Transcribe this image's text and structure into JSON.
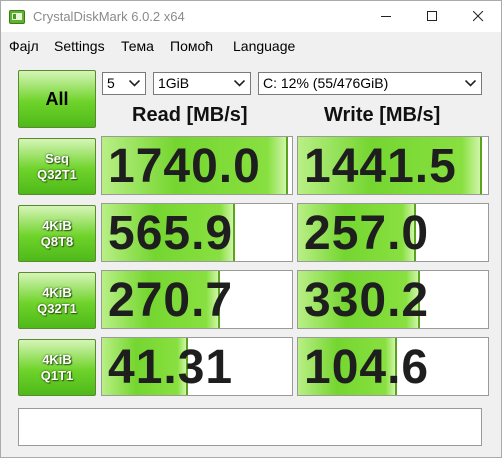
{
  "window": {
    "title": "CrystalDiskMark 6.0.2 x64"
  },
  "menu": [
    "Фајл",
    "Settings",
    "Тема",
    "Помоћ",
    "Language"
  ],
  "controls": {
    "all_label": "All",
    "count": "5",
    "size": "1GiB",
    "drive": "C: 12% (55/476GiB)"
  },
  "headers": {
    "read": "Read [MB/s]",
    "write": "Write [MB/s]"
  },
  "tests": [
    {
      "line1": "Seq",
      "line2": "Q32T1",
      "read": "1740.0",
      "write": "1441.5",
      "read_fill_pct": 98,
      "write_fill_pct": 97
    },
    {
      "line1": "4KiB",
      "line2": "Q8T8",
      "read": "565.9",
      "write": "257.0",
      "read_fill_pct": 70,
      "write_fill_pct": 62
    },
    {
      "line1": "4KiB",
      "line2": "Q32T1",
      "read": "270.7",
      "write": "330.2",
      "read_fill_pct": 62,
      "write_fill_pct": 64
    },
    {
      "line1": "4KiB",
      "line2": "Q1T1",
      "read": "41.31",
      "write": "104.6",
      "read_fill_pct": 45,
      "write_fill_pct": 52
    }
  ],
  "status": "",
  "colors": {
    "button_green": "#6ed32a",
    "bar_green": "#75d630"
  }
}
